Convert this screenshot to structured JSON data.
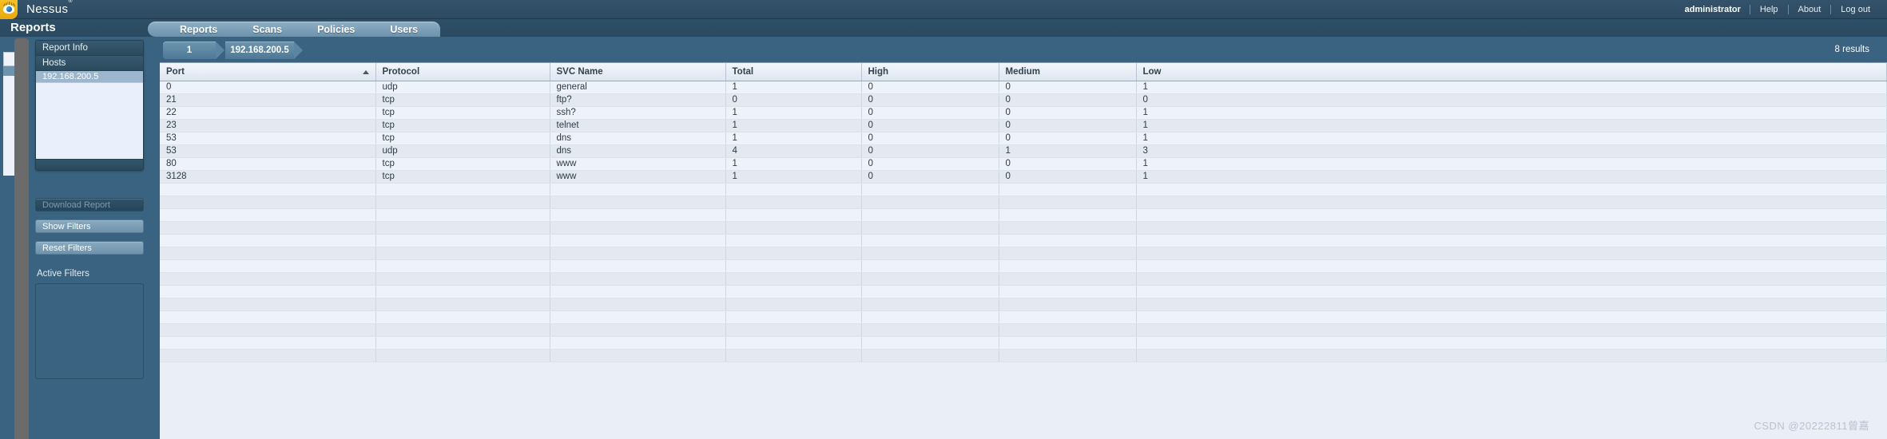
{
  "brand": {
    "name": "Nessus",
    "trademark": "®",
    "logo_icon": "eye-logo-icon"
  },
  "topnav": {
    "user": "administrator",
    "links": [
      "Help",
      "About",
      "Log out"
    ]
  },
  "section": {
    "title": "Reports"
  },
  "nav": {
    "items": [
      "Reports",
      "Scans",
      "Policies",
      "Users"
    ],
    "active": "Reports"
  },
  "sidebar": {
    "report_info_label": "Report Info",
    "hosts_label": "Hosts",
    "hosts": [
      "192.168.200.5"
    ],
    "selected_host": "192.168.200.5",
    "download_button": "Download Report",
    "show_filters_button": "Show Filters",
    "reset_filters_button": "Reset Filters",
    "active_filters_label": "Active Filters",
    "active_filters": []
  },
  "breadcrumb": {
    "items": [
      "1",
      "192.168.200.5"
    ]
  },
  "results": {
    "count_text": "8  results"
  },
  "table": {
    "columns": [
      "Port",
      "Protocol",
      "SVC Name",
      "Total",
      "High",
      "Medium",
      "Low"
    ],
    "sort_column": "Port",
    "sort_direction": "asc",
    "rows": [
      {
        "port": "0",
        "protocol": "udp",
        "svc_name": "general",
        "total": "1",
        "high": "0",
        "medium": "0",
        "low": "1"
      },
      {
        "port": "21",
        "protocol": "tcp",
        "svc_name": "ftp?",
        "total": "0",
        "high": "0",
        "medium": "0",
        "low": "0"
      },
      {
        "port": "22",
        "protocol": "tcp",
        "svc_name": "ssh?",
        "total": "1",
        "high": "0",
        "medium": "0",
        "low": "1"
      },
      {
        "port": "23",
        "protocol": "tcp",
        "svc_name": "telnet",
        "total": "1",
        "high": "0",
        "medium": "0",
        "low": "1"
      },
      {
        "port": "53",
        "protocol": "tcp",
        "svc_name": "dns",
        "total": "1",
        "high": "0",
        "medium": "0",
        "low": "1"
      },
      {
        "port": "53",
        "protocol": "udp",
        "svc_name": "dns",
        "total": "4",
        "high": "0",
        "medium": "1",
        "low": "3"
      },
      {
        "port": "80",
        "protocol": "tcp",
        "svc_name": "www",
        "total": "1",
        "high": "0",
        "medium": "0",
        "low": "1"
      },
      {
        "port": "3128",
        "protocol": "tcp",
        "svc_name": "www",
        "total": "1",
        "high": "0",
        "medium": "0",
        "low": "1"
      }
    ]
  },
  "watermark": {
    "text": "CSDN @20222811曾嘉"
  },
  "colors": {
    "brand_yellow": "#f0b41a",
    "header_dark": "#2d4a60",
    "page_blue": "#3a6381",
    "high": "#d0322e",
    "medium": "#e08a20",
    "low": "#5c86c4",
    "row_odd": "#eef3fb",
    "row_even": "#e3e9f1"
  }
}
